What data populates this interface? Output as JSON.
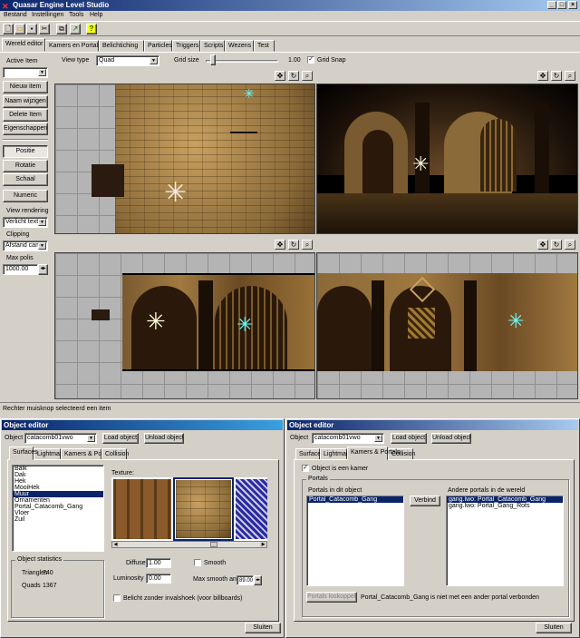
{
  "main": {
    "title": "Quasar Engine Level Studio",
    "menu": [
      "Bestand",
      "Instellingen",
      "Tools",
      "Help"
    ],
    "tabs": [
      "Wereld editor",
      "Kamers en Portals",
      "Belichtiching",
      "Particles",
      "Triggers",
      "Scripts",
      "Wezens",
      "Test"
    ],
    "left": {
      "active_item_label": "Active Item",
      "active_item_value": "",
      "buttons": [
        "Nieuw item",
        "Naam wijzigen",
        "Delete Item",
        "Eigenschappen"
      ],
      "transform_buttons": [
        "Positie",
        "Rotatie",
        "Schaal"
      ],
      "numeric": "Numeric",
      "view_rendering_label": "View rendering",
      "view_rendering_value": "Verlicht textu",
      "clipping_label": "Clipping",
      "clipping_value": "Afstand came",
      "max_polis_label": "Max polis",
      "max_polis_value": "1000.00"
    },
    "toolbar2": {
      "view_type_label": "View type",
      "view_type_value": "Quad",
      "grid_size_label": "Grid size",
      "grid_size_value": "1.00",
      "grid_snap_label": "Grid Snap",
      "grid_snap_checked": true
    },
    "status": "Rechter muisknop selecteerd een item"
  },
  "left_editor": {
    "title": "Object editor",
    "object_label": "Object",
    "object_value": "catacomb01vwo",
    "load": "Load object",
    "unload": "Unload object",
    "tabs": [
      "Surfaces",
      "Lightmaps",
      "Kamers & Portals",
      "Collision"
    ],
    "surfaces": [
      "Balk",
      "Dak",
      "Hek",
      "MooiHek",
      "Muur",
      "Ornamenten",
      "Portal_Catacomb_Gang",
      "Vloer",
      "Zuil"
    ],
    "selected_surface": "Muur",
    "texture_label": "Texture:",
    "stats_title": "Object statistics",
    "triangles_label": "Triangles",
    "triangles": "740",
    "quads_label": "Quads",
    "quads": "1367",
    "diffuse_label": "Diffuse",
    "diffuse": "1.00",
    "smooth_label": "Smooth",
    "luminosity_label": "Luminosity",
    "luminosity": "0.00",
    "max_smooth_label": "Max smooth angle",
    "max_smooth": "89.00",
    "billboard_label": "Belicht zonder invalshoek (voor billboards)",
    "close": "Sluiten"
  },
  "right_editor": {
    "title": "Object editor",
    "object_label": "Object",
    "object_value": "catacomb01vwo",
    "load": "Load object",
    "unload": "Unload object",
    "tabs": [
      "Surfaces",
      "Lightmaps",
      "Kamers & Portals",
      "Collision"
    ],
    "is_room_label": "Object is een kamer",
    "portals_group": "Portals",
    "portals_in_object_label": "Portals in dit object",
    "portals_in_object": [
      "Portal_Catacomb_Gang"
    ],
    "connect": "Verbind",
    "other_portals_label": "Andere portals in de wereld",
    "other_portals": [
      "gang.lwo: Portal_Catacomb_Gang",
      "gang.lwo: Portal_Gang_Rots"
    ],
    "disconnect": "Portals loskoppelen",
    "portal_status": "Portal_Catacomb_Gang is niet met een ander portal verbonden",
    "close": "Sluiten"
  }
}
